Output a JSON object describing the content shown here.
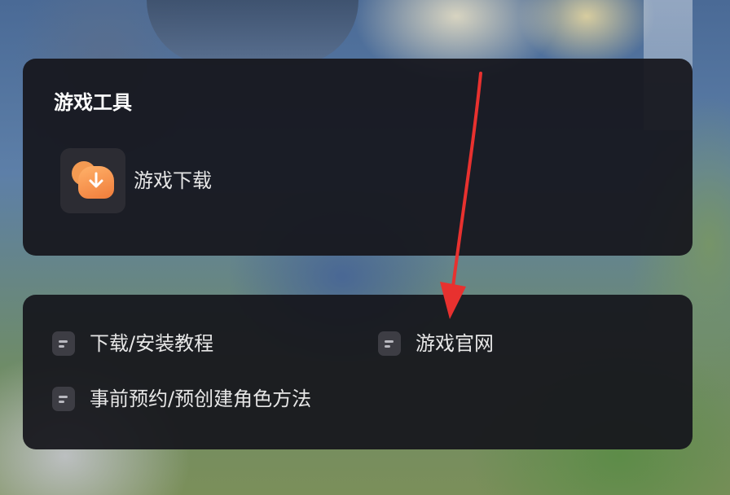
{
  "tools_panel": {
    "title": "游戏工具",
    "items": [
      {
        "label": "游戏下载",
        "icon": "game-download-icon"
      }
    ]
  },
  "links_panel": {
    "items": [
      {
        "label": "下载/安装教程",
        "icon": "document-icon"
      },
      {
        "label": "游戏官网",
        "icon": "document-icon"
      },
      {
        "label": "事前预约/预创建角色方法",
        "icon": "document-icon"
      }
    ]
  },
  "colors": {
    "panel_bg": "#16161c",
    "icon_orange": "#f07c3a",
    "annotation_arrow": "#e8312f"
  }
}
